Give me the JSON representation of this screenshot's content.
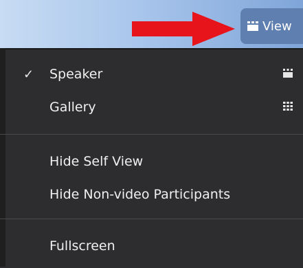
{
  "toolbar": {
    "view_label": "View"
  },
  "menu": {
    "items": [
      {
        "label": "Speaker",
        "checked": true,
        "check_glyph": "✓",
        "icon": "speaker-layout-icon"
      },
      {
        "label": "Gallery",
        "checked": false,
        "icon": "gallery-grid-icon"
      },
      {
        "label": "Hide Self View"
      },
      {
        "label": "Hide Non-video Participants"
      },
      {
        "label": "Fullscreen"
      }
    ]
  },
  "colors": {
    "menu_bg": "#2d2d2f",
    "topbar_light": "#c8dcf3",
    "view_button": "#5f7fb0",
    "arrow": "#e8141c"
  }
}
